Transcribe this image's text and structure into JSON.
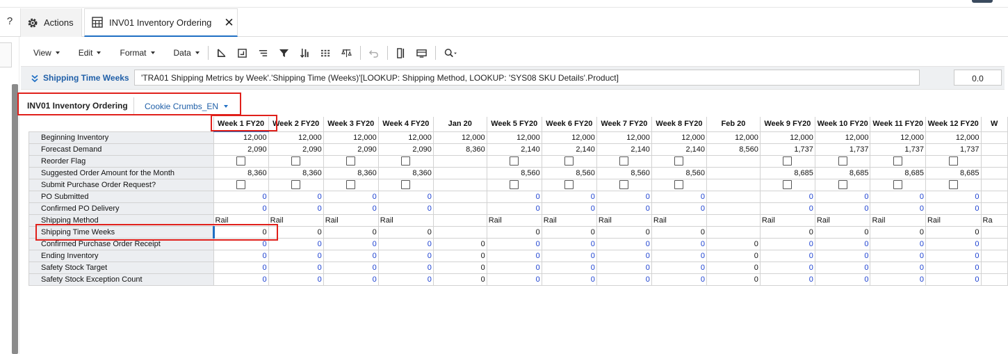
{
  "tabs": {
    "help": "?",
    "actions_label": "Actions",
    "current_label": "INV01 Inventory Ordering",
    "close_glyph": "✕"
  },
  "toolbar": {
    "menus": [
      "View",
      "Edit",
      "Format",
      "Data"
    ],
    "icons": [
      "pivot-icon",
      "insert-icon",
      "sort-lines-icon",
      "filter-icon",
      "sort-numeric-icon",
      "grid-icon",
      "balance-icon",
      "undo-icon",
      "freeze-columns-icon",
      "table-view-icon",
      "search-icon"
    ]
  },
  "formula_bar": {
    "label": "Shipping Time Weeks",
    "expression": "'TRA01 Shipping Metrics by Week'.'Shipping Time (Weeks)'[LOOKUP: Shipping Method, LOOKUP: 'SYS08 SKU Details'.Product]",
    "value": "0.0"
  },
  "module": {
    "title": "INV01 Inventory Ordering",
    "page_selector": "Cookie Crumbs_EN"
  },
  "grid": {
    "columns": [
      "Week 1 FY20",
      "Week 2 FY20",
      "Week 3 FY20",
      "Week 4 FY20",
      "Jan 20",
      "Week 5 FY20",
      "Week 6 FY20",
      "Week 7 FY20",
      "Week 8 FY20",
      "Feb 20",
      "Week 9 FY20",
      "Week 10 FY20",
      "Week 11 FY20",
      "Week 12 FY20",
      "W"
    ],
    "rows": [
      {
        "label": "Beginning Inventory",
        "kind": "num",
        "cells": [
          "12,000",
          "12,000",
          "12,000",
          "12,000",
          "12,000",
          "12,000",
          "12,000",
          "12,000",
          "12,000",
          "12,000",
          "12,000",
          "12,000",
          "12,000",
          "12,000",
          ""
        ]
      },
      {
        "label": "Forecast Demand",
        "kind": "num",
        "cells": [
          "2,090",
          "2,090",
          "2,090",
          "2,090",
          "8,360",
          "2,140",
          "2,140",
          "2,140",
          "2,140",
          "8,560",
          "1,737",
          "1,737",
          "1,737",
          "1,737",
          ""
        ]
      },
      {
        "label": "Reorder Flag",
        "kind": "check",
        "cells": [
          "cb",
          "cb",
          "cb",
          "cb",
          "",
          "cb",
          "cb",
          "cb",
          "cb",
          "",
          "cb",
          "cb",
          "cb",
          "cb",
          ""
        ]
      },
      {
        "label": "Suggested Order Amount for the Month",
        "kind": "num",
        "cells": [
          "8,360",
          "8,360",
          "8,360",
          "8,360",
          "",
          "8,560",
          "8,560",
          "8,560",
          "8,560",
          "",
          "8,685",
          "8,685",
          "8,685",
          "8,685",
          ""
        ]
      },
      {
        "label": "Submit Purchase Order Request?",
        "kind": "check",
        "cells": [
          "cb",
          "cb",
          "cb",
          "cb",
          "",
          "cb",
          "cb",
          "cb",
          "cb",
          "",
          "cb",
          "cb",
          "cb",
          "cb",
          ""
        ]
      },
      {
        "label": "PO Submitted",
        "kind": "ent",
        "cells": [
          "0",
          "0",
          "0",
          "0",
          "",
          "0",
          "0",
          "0",
          "0",
          "",
          "0",
          "0",
          "0",
          "0",
          ""
        ]
      },
      {
        "label": "Confirmed PO Delivery",
        "kind": "ent",
        "cells": [
          "0",
          "0",
          "0",
          "0",
          "",
          "0",
          "0",
          "0",
          "0",
          "",
          "0",
          "0",
          "0",
          "0",
          ""
        ]
      },
      {
        "label": "Shipping Method",
        "kind": "txt",
        "cells": [
          "Rail",
          "Rail",
          "Rail",
          "Rail",
          "",
          "Rail",
          "Rail",
          "Rail",
          "Rail",
          "",
          "Rail",
          "Rail",
          "Rail",
          "Rail",
          "Ra"
        ]
      },
      {
        "label": "Shipping Time Weeks",
        "kind": "num",
        "cells": [
          "0",
          "0",
          "0",
          "0",
          "",
          "0",
          "0",
          "0",
          "0",
          "",
          "0",
          "0",
          "0",
          "0",
          ""
        ]
      },
      {
        "label": "Confirmed Purchase Order Receipt",
        "kind": "mix",
        "cells": [
          "0",
          "0",
          "0",
          "0",
          "0",
          "0",
          "0",
          "0",
          "0",
          "0",
          "0",
          "0",
          "0",
          "0",
          ""
        ]
      },
      {
        "label": "Ending Inventory",
        "kind": "mix",
        "cells": [
          "0",
          "0",
          "0",
          "0",
          "0",
          "0",
          "0",
          "0",
          "0",
          "0",
          "0",
          "0",
          "0",
          "0",
          ""
        ]
      },
      {
        "label": "Safety Stock Target",
        "kind": "mix",
        "cells": [
          "0",
          "0",
          "0",
          "0",
          "0",
          "0",
          "0",
          "0",
          "0",
          "0",
          "0",
          "0",
          "0",
          "0",
          ""
        ]
      },
      {
        "label": "Safety Stock Exception Count",
        "kind": "mix",
        "cells": [
          "0",
          "0",
          "0",
          "0",
          "0",
          "0",
          "0",
          "0",
          "0",
          "0",
          "0",
          "0",
          "0",
          "0",
          ""
        ]
      }
    ]
  }
}
